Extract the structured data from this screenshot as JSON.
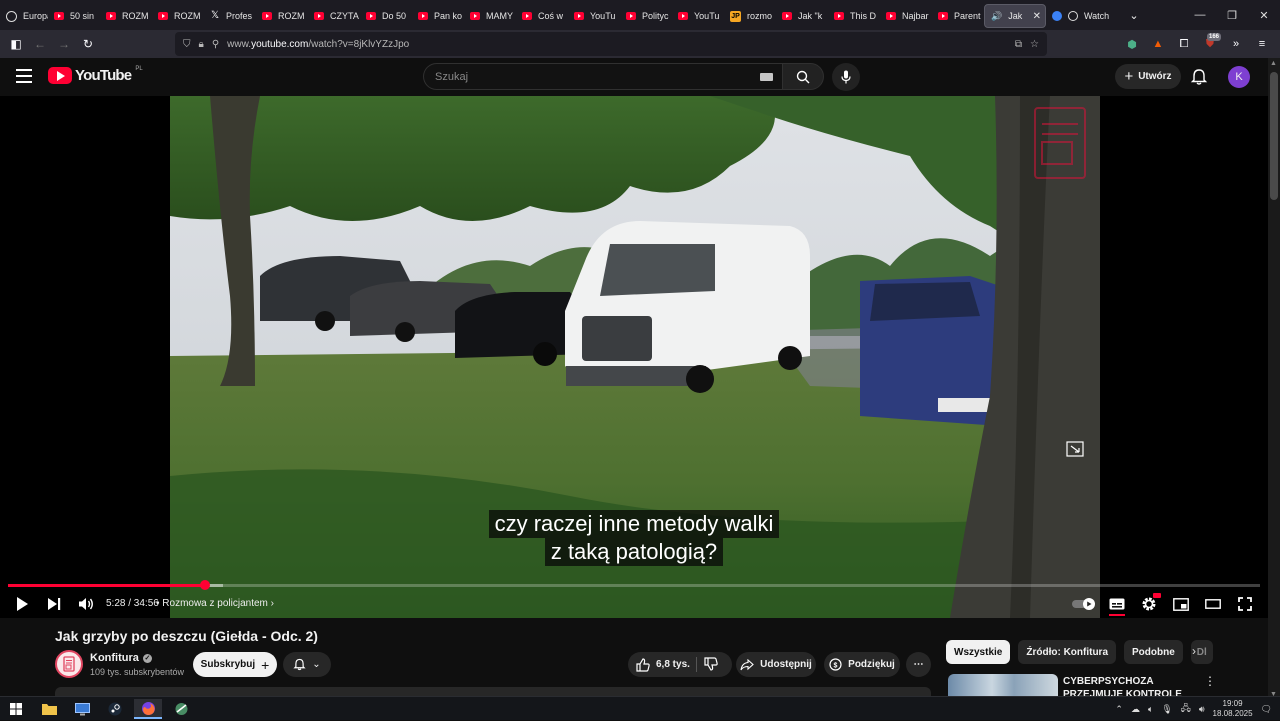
{
  "browser": {
    "tabs": [
      {
        "label": "Europa",
        "icon": "globe-icon"
      },
      {
        "label": "50 sin",
        "icon": "youtube-icon"
      },
      {
        "label": "ROZM",
        "icon": "youtube-icon"
      },
      {
        "label": "ROZM",
        "icon": "youtube-icon"
      },
      {
        "label": "Profes",
        "icon": "x-icon"
      },
      {
        "label": "ROZM",
        "icon": "youtube-icon"
      },
      {
        "label": "CZYTA",
        "icon": "youtube-icon"
      },
      {
        "label": "Do 50",
        "icon": "youtube-icon"
      },
      {
        "label": "Pan ko",
        "icon": "youtube-icon"
      },
      {
        "label": "MAMY",
        "icon": "youtube-icon"
      },
      {
        "label": "Coś w",
        "icon": "youtube-icon"
      },
      {
        "label": "YouTu",
        "icon": "youtube-icon"
      },
      {
        "label": "Polityc",
        "icon": "youtube-icon"
      },
      {
        "label": "YouTu",
        "icon": "youtube-icon"
      },
      {
        "label": "rozmo",
        "icon": "jp-icon"
      },
      {
        "label": "Jak \"k",
        "icon": "youtube-icon"
      },
      {
        "label": "This D",
        "icon": "youtube-icon"
      },
      {
        "label": "Najbar",
        "icon": "youtube-icon"
      },
      {
        "label": "Parent",
        "icon": "youtube-icon"
      }
    ],
    "active_tab": {
      "label": "Jak"
    },
    "watch_tab": {
      "label": "Watch"
    },
    "url_prefix": "www.",
    "url_domain": "youtube.com",
    "url_path": "/watch?v=8jKlvYZzJpo",
    "extension_badge": "166"
  },
  "masthead": {
    "logo_text": "YouTube",
    "region": "PL",
    "search_placeholder": "Szukaj",
    "create_label": "Utwórz",
    "avatar_letter": "K"
  },
  "player": {
    "captions": [
      "czy raczej inne metody walki",
      "z taką patologią?"
    ],
    "time": "5:28 / 34:56",
    "chapter": "Rozmowa z policjantem",
    "progress": 0.157,
    "buffered": 0.172
  },
  "video": {
    "title": "Jak grzyby po deszczu (Giełda - Odc. 2)",
    "channel": "Konfitura",
    "subscribers": "109 tys. subskrybentów",
    "subscribe_label": "Subskrybuj",
    "likes": "6,8 tys.",
    "share_label": "Udostępnij",
    "thanks_label": "Podziękuj"
  },
  "sidebar": {
    "chips": [
      "Wszystkie",
      "Źródło: Konfitura",
      "Podobne",
      "Dl"
    ],
    "recommendation_title": "CYBERPSYCHOZA PRZEJMUJE KONTROLĘ"
  },
  "taskbar": {
    "time": "19:09",
    "date": "18.08.2025"
  },
  "colors": {
    "accent": "#ff0033",
    "background": "#0f0f0f",
    "avatar": "#7e3fd1"
  }
}
